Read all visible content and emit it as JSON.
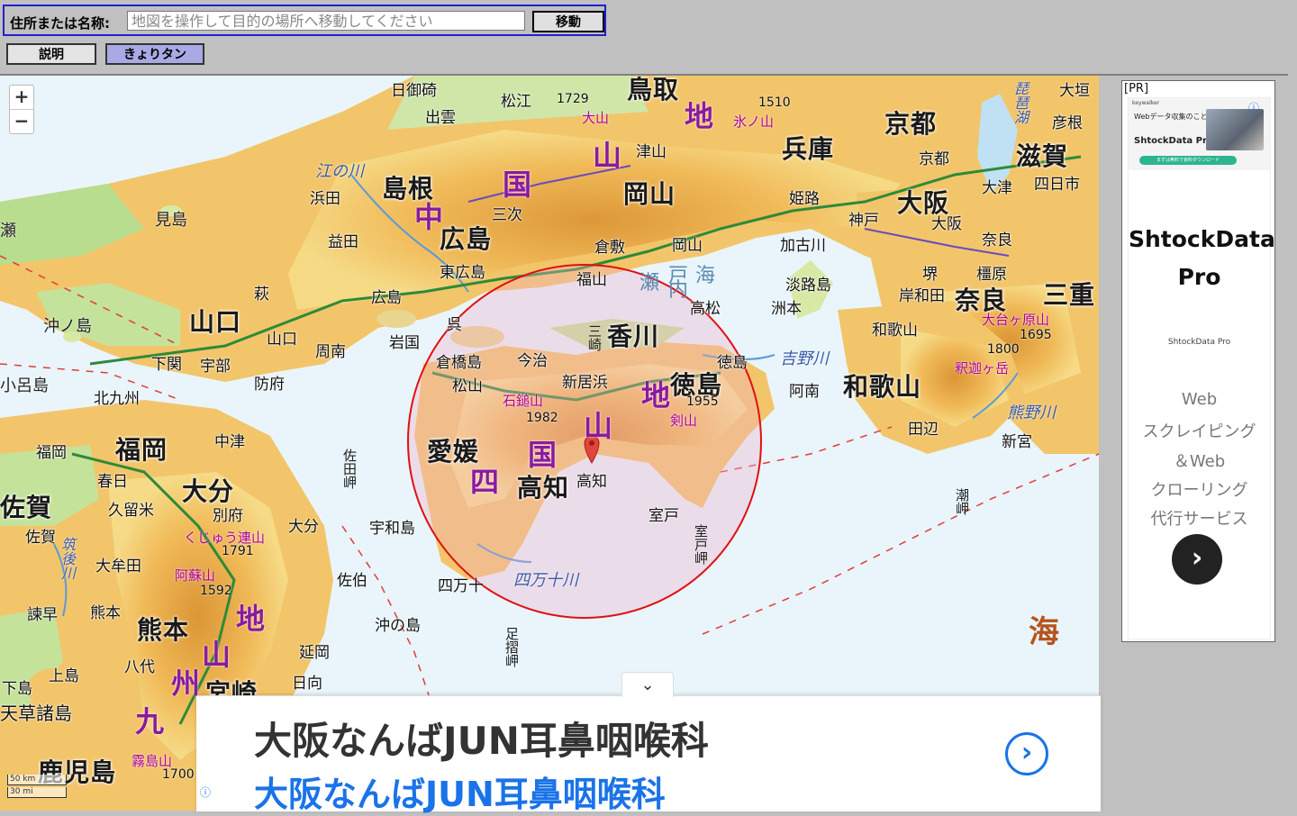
{
  "toolbar": {
    "search_label": "住所または名称:",
    "search_value": "",
    "search_placeholder": "地図を操作して目的の場所へ移動してください",
    "move_button": "移動",
    "help_button": "説明",
    "distance_button": "きょりタン"
  },
  "map": {
    "zoom_in": "+",
    "zoom_out": "−",
    "scale_km": "50 km",
    "scale_mi": "30 mi",
    "prefectures": [
      "鳥取",
      "京都",
      "滋賀",
      "島根",
      "兵庫",
      "岡山",
      "大阪",
      "広島",
      "奈良",
      "三重",
      "山口",
      "香川",
      "徳島",
      "和歌山",
      "愛媛",
      "高知",
      "福岡",
      "大分",
      "佐賀",
      "熊本",
      "宮崎",
      "鹿児島"
    ],
    "cities": [
      "日御碕",
      "松江",
      "出雲",
      "大垣",
      "彦根",
      "京都",
      "津山",
      "大津",
      "四日市",
      "浜田",
      "三次",
      "姫路",
      "神戸",
      "大阪",
      "岡山",
      "倉敷",
      "奈良",
      "加古川",
      "益田",
      "東広島",
      "福山",
      "堺",
      "橿原",
      "萩",
      "広島",
      "淡路島",
      "洲本",
      "岸和田",
      "和歌山",
      "呉",
      "岩国",
      "高松",
      "山口",
      "周南",
      "今治",
      "徳島",
      "防府",
      "宇部",
      "下関",
      "倉橋島",
      "松山",
      "新居浜",
      "阿南",
      "北九州",
      "中津",
      "田辺",
      "福岡",
      "新宮",
      "春日",
      "高知",
      "大分",
      "久留米",
      "別府",
      "室戸",
      "宇和島",
      "佐賀",
      "大牟田",
      "佐伯",
      "四万十",
      "諫早",
      "熊本",
      "延岡",
      "八代",
      "日向",
      "沖の島",
      "上島",
      "下島",
      "天草諸島"
    ],
    "islands": [
      "見島",
      "沖ノ島",
      "小呂島",
      "瀬"
    ],
    "mountains": [
      "大山",
      "氷ノ山",
      "石鎚山",
      "剣山",
      "大台ヶ原山",
      "釈迦ヶ岳",
      "くじゅう連山",
      "阿蘇山",
      "霧島山"
    ],
    "peaks": [
      "1729",
      "1510",
      "1982",
      "1955",
      "1800",
      "1695",
      "1791",
      "1592",
      "1700"
    ],
    "rivers": [
      "江の川",
      "吉野川",
      "熊野川",
      "四万十川",
      "筑後川",
      "琵琶湖"
    ],
    "capes": [
      "三崎",
      "佐田岬",
      "室戸岬",
      "足摺岬",
      "潮岬"
    ],
    "ranges": [
      "中",
      "国",
      "山",
      "地",
      "四",
      "国",
      "山",
      "地",
      "九",
      "州",
      "山",
      "地"
    ],
    "seas": [
      "瀬",
      "戸",
      "内",
      "海",
      "海"
    ]
  },
  "bottom_ad": {
    "collapse_icon": "chevron-down",
    "headline": "大阪なんばJUN耳鼻咽喉科",
    "subline": "大阪なんばJUN耳鼻咽喉科",
    "arrow": "›",
    "info": "ⓘ"
  },
  "side_ad": {
    "pr_label": "[PR]",
    "banner_small": "keywalker",
    "banner_copy": "Webデータ収集のことは 全ておまかせ!",
    "banner_brand": "ShtockData Pro",
    "banner_button": "まずは無料で資料ダウンロード",
    "title_line1": "ShtockData",
    "title_line2": "Pro",
    "small_brand": "ShtockData Pro",
    "desc": [
      "Web",
      "スクレイピング",
      "＆Web",
      "クローリング",
      "代行サービス"
    ],
    "arrow": "›",
    "info": "ⓘ"
  }
}
